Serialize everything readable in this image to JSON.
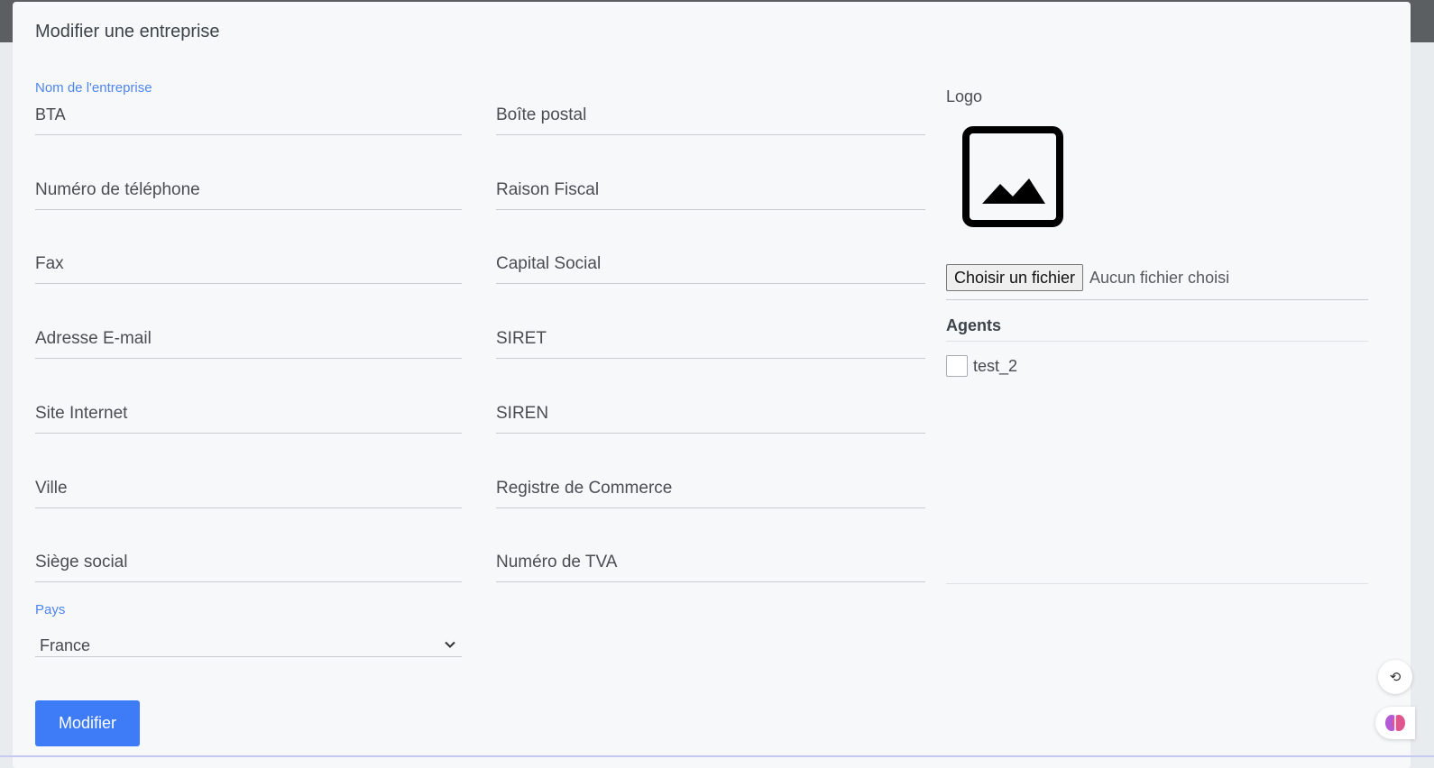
{
  "modal": {
    "title": "Modifier une entreprise"
  },
  "form": {
    "company_name": {
      "label": "Nom de l'entreprise",
      "value": "BTA"
    },
    "left_fields": [
      "Numéro de téléphone",
      "Fax",
      "Adresse E-mail",
      "Site Internet",
      "Ville",
      "Siège social"
    ],
    "right_fields": [
      "Boîte postal",
      "Raison Fiscal",
      "Capital Social",
      "SIRET",
      "SIREN",
      "Registre de Commerce",
      "Numéro de TVA"
    ],
    "country": {
      "label": "Pays",
      "value": "France"
    },
    "submit_label": "Modifier"
  },
  "logo": {
    "label": "Logo",
    "file_button": "Choisir un fichier",
    "file_status": "Aucun fichier choisi"
  },
  "agents": {
    "title": "Agents",
    "items": [
      {
        "label": "test_2",
        "checked": false
      }
    ]
  }
}
